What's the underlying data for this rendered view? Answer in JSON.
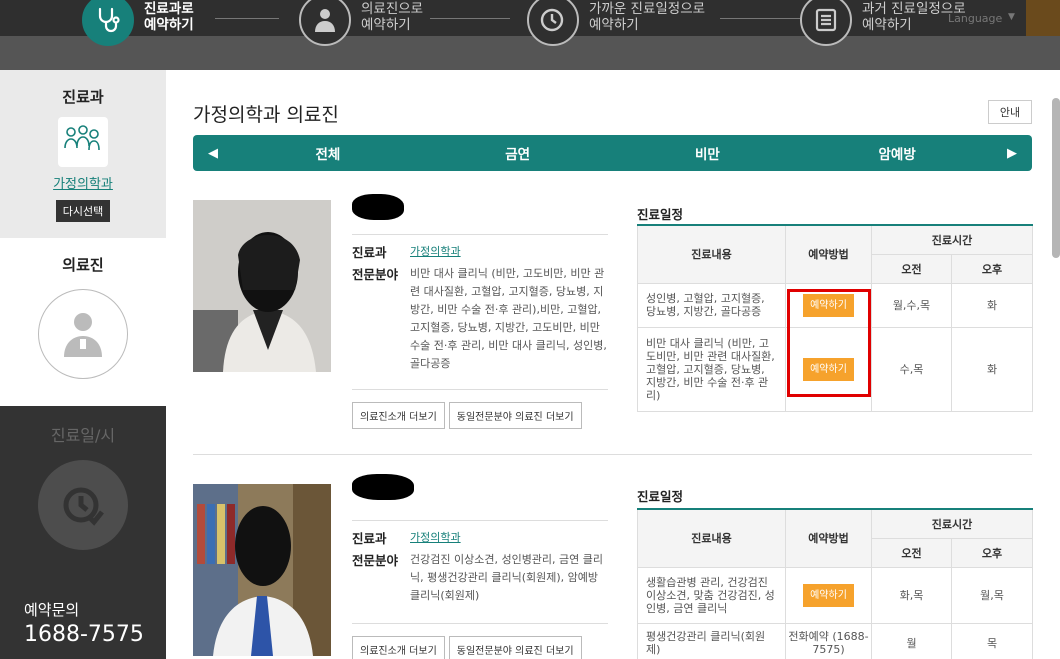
{
  "steps": [
    {
      "label": "진료과로\n예약하기",
      "active": true
    },
    {
      "label": "의료진으로\n예약하기",
      "active": false
    },
    {
      "label": "가까운 진료일정으로\n예약하기",
      "active": false
    },
    {
      "label": "과거 진료일정으로\n예약하기",
      "active": false
    }
  ],
  "topbar": {
    "language": "Language"
  },
  "left": {
    "dept_title": "진료과",
    "dept_name": "가정의학과",
    "reselect": "다시선택",
    "doctor_title": "의료진",
    "schedule_title": "진료일/시",
    "inquiry_label": "예약문의",
    "inquiry_phone": "1688-7575"
  },
  "main": {
    "page_title": "가정의학과 의료진",
    "info_button": "안내",
    "tabs": [
      "전체",
      "금연",
      "비만",
      "암예방"
    ]
  },
  "doctors": [
    {
      "dept_label": "진료과",
      "dept_value": "가정의학과",
      "specialty_label": "전문분야",
      "specialty_value": "비만 대사 클리닉 (비만, 고도비만, 비만 관련 대사질환, 고혈압, 고지혈증, 당뇨병, 지방간, 비만 수술 전·후 관리),비만, 고혈압, 고지혈증, 당뇨병, 지방간, 고도비만, 비만 수술 전·후 관리, 비만 대사 클리닉, 성인병, 골다공증",
      "btn_intro": "의료진소개 더보기",
      "btn_same": "동일전문분야 의료진 더보기",
      "schedule_title": "진료일정",
      "headers": {
        "content": "진료내용",
        "method": "예약방법",
        "time": "진료시간",
        "am": "오전",
        "pm": "오후"
      },
      "rows": [
        {
          "content": "성인병, 고혈압, 고지혈증, 당뇨병, 지방간, 골다공증",
          "method": "예약하기",
          "am": "월,수,목",
          "pm": "화"
        },
        {
          "content": "비만 대사 클리닉 (비만, 고도비만, 비만 관련 대사질환, 고혈압, 고지혈증, 당뇨병, 지방간, 비만 수술 전·후 관리)",
          "method": "예약하기",
          "am": "수,목",
          "pm": "화"
        }
      ]
    },
    {
      "dept_label": "진료과",
      "dept_value": "가정의학과",
      "specialty_label": "전문분야",
      "specialty_value": "건강검진 이상소견, 성인병관리, 금연 클리닉, 평생건강관리 클리닉(회원제), 암예방 클리닉(회원제)",
      "btn_intro": "의료진소개 더보기",
      "btn_same": "동일전문분야 의료진 더보기",
      "schedule_title": "진료일정",
      "headers": {
        "content": "진료내용",
        "method": "예약방법",
        "time": "진료시간",
        "am": "오전",
        "pm": "오후"
      },
      "rows": [
        {
          "content": "생활습관병 관리, 건강검진 이상소견, 맞춤 건강검진, 성인병, 금연 클리닉",
          "method": "예약하기",
          "am": "화,목",
          "pm": "월,목"
        },
        {
          "content": "평생건강관리 클리닉(회원제)",
          "method": "전화예약 (1688-7575)",
          "am": "월",
          "pm": "목"
        }
      ]
    }
  ],
  "colors": {
    "accent": "#17807a",
    "reserve": "#f6a22c",
    "highlight": "#e00000"
  }
}
